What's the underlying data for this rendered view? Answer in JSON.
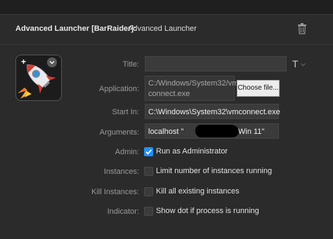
{
  "header": {
    "plugin_name": "Advanced Launcher [BarRaider]:",
    "action_name": "Advanced Launcher"
  },
  "icons": {
    "trash": "trash-icon",
    "rocket": "rocket-icon",
    "plus": "+",
    "title_options": "T",
    "chevron": "⌵"
  },
  "form": {
    "title_label": "Title:",
    "title_value": "",
    "application_label": "Application:",
    "application_value": "C:/Windows/System32/vmconnect.exe",
    "application_line1": "C:/Windows/System32/vm",
    "application_line2": "connect.exe",
    "choose_file_label": "Choose file...",
    "start_in_label": "Start In:",
    "start_in_value": "C:\\Windows\\System32\\vmconnect.exe",
    "arguments_label": "Arguments:",
    "arguments_value_prefix": "localhost \"",
    "arguments_value_suffix": "Win 11\"",
    "admin_label": "Admin:",
    "admin_checked": true,
    "admin_option": "Run as Administrator",
    "instances_label": "Instances:",
    "instances_checked": false,
    "instances_option": "Limit number of instances running",
    "kill_label": "Kill Instances:",
    "kill_checked": false,
    "kill_option": "Kill all existing instances",
    "indicator_label": "Indicator:",
    "indicator_checked": false,
    "indicator_option": "Show dot if process is running"
  },
  "colors": {
    "background": "#2b2b2b",
    "field": "#3b3b3b",
    "accent": "#1e90ff"
  }
}
